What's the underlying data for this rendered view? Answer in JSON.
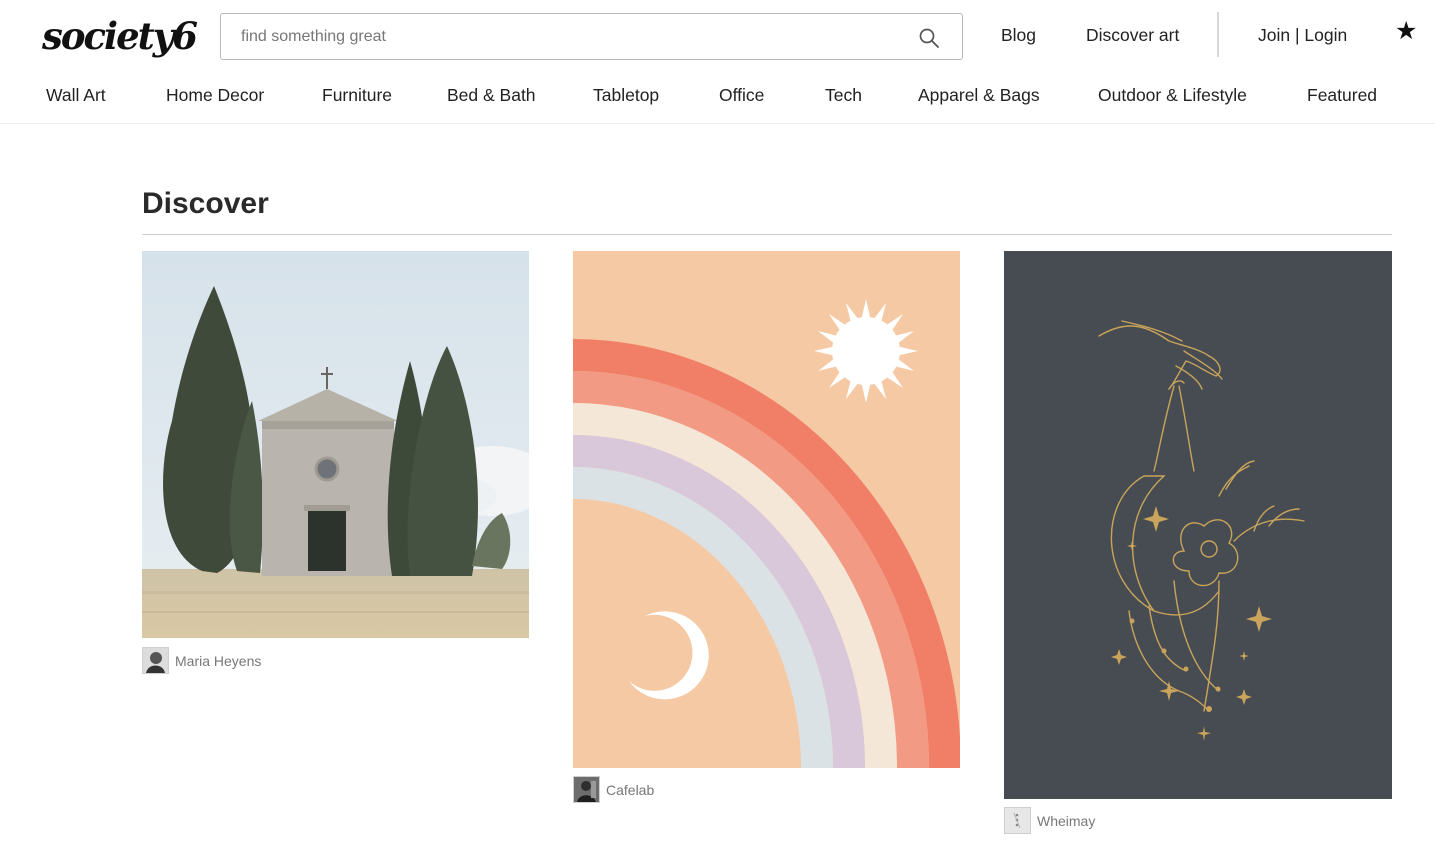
{
  "header": {
    "logo": "society6",
    "search": {
      "placeholder": "find something great",
      "value": ""
    },
    "links": {
      "blog": "Blog",
      "discover": "Discover art",
      "account": "Join | Login"
    },
    "wishlist_icon": "star-icon"
  },
  "nav": {
    "items": [
      {
        "label": "Wall Art"
      },
      {
        "label": "Home Decor"
      },
      {
        "label": "Furniture"
      },
      {
        "label": "Bed & Bath"
      },
      {
        "label": "Tabletop"
      },
      {
        "label": "Office"
      },
      {
        "label": "Tech"
      },
      {
        "label": "Apparel & Bags"
      },
      {
        "label": "Outdoor & Lifestyle"
      },
      {
        "label": "Featured"
      }
    ]
  },
  "main": {
    "title": "Discover",
    "cards": [
      {
        "artist": "Maria Heyens"
      },
      {
        "artist": "Cafelab"
      },
      {
        "artist": "Wheimay"
      }
    ]
  },
  "colors": {
    "text": "#222222",
    "muted": "#777777",
    "rainbow_bg": "#f5c9a3",
    "rainbow_red": "#f17f67",
    "rainbow_salmon": "#f39a84",
    "rainbow_cream": "#f4e7d8",
    "rainbow_lilac": "#d8c8da",
    "rainbow_blue": "#dbe2e6",
    "dark_panel": "#474c52",
    "gold": "#c9a45a"
  }
}
